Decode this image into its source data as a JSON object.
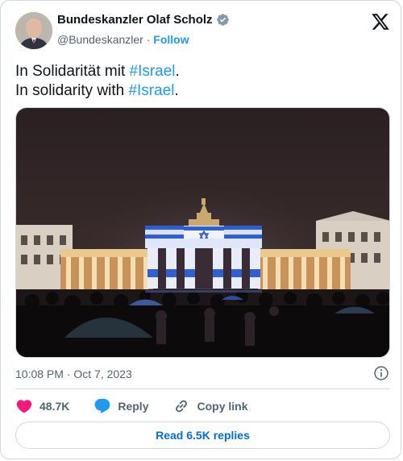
{
  "author": {
    "name": "Bundeskanzler Olaf Scholz",
    "handle": "@Bundeskanzler",
    "separator": "·",
    "follow_label": "Follow",
    "verified_color": "#829aab"
  },
  "tweet": {
    "line1_prefix": "In Solidarität mit ",
    "line1_hashtag": "#Israel",
    "line1_suffix": ".",
    "line2_prefix": "In solidarity with ",
    "line2_hashtag": "#Israel",
    "line2_suffix": "."
  },
  "meta": {
    "timestamp": "10:08 PM · Oct 7, 2023"
  },
  "actions": {
    "likes": "48.7K",
    "reply_label": "Reply",
    "copy_link_label": "Copy link",
    "read_replies_label": "Read 6.5K replies"
  },
  "colors": {
    "accent": "#1d9bf0",
    "like": "#f91880",
    "muted": "#536471"
  }
}
